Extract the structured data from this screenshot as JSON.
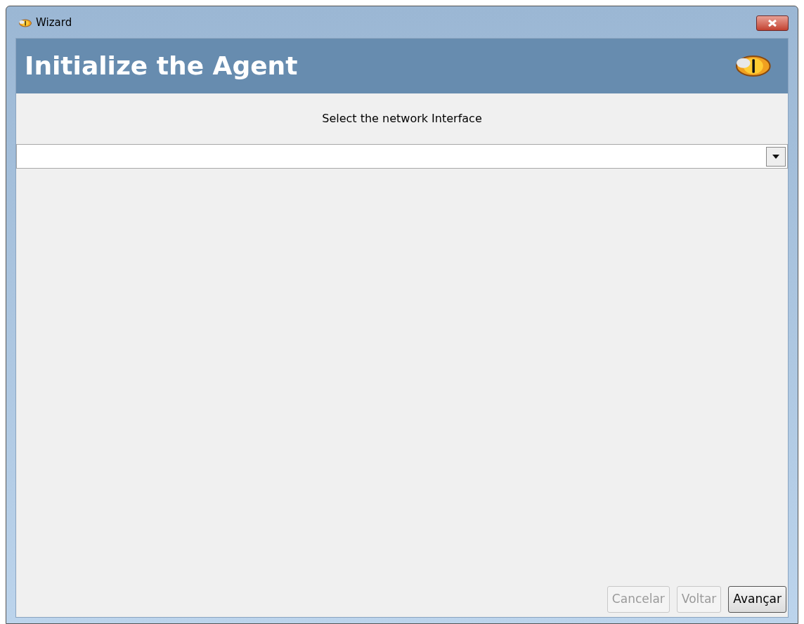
{
  "window": {
    "title": "Wizard"
  },
  "header": {
    "title": "Initialize the Agent"
  },
  "prompt": "Select the network Interface",
  "buttons": [
    {
      "label": "Cancelar",
      "disabled": true
    },
    {
      "label": "Voltar",
      "disabled": true
    },
    {
      "label": "Avançar",
      "disabled": false
    }
  ]
}
